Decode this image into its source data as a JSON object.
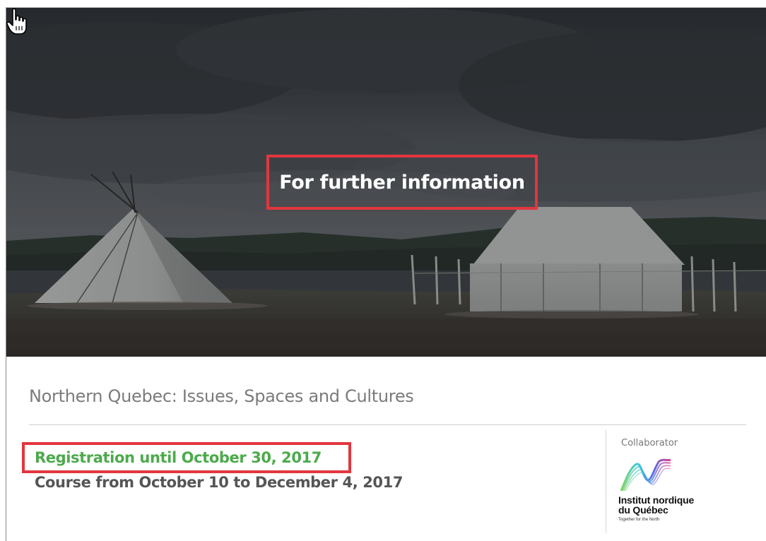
{
  "hero": {
    "link_label": "For further information",
    "image_description_icon": "tents-landscape-photo"
  },
  "course": {
    "title": "Northern Quebec: Issues, Spaces and Cultures",
    "registration": "Registration until October 30, 2017",
    "dates": "Course from October 10 to December 4, 2017"
  },
  "collaborator": {
    "label": "Collaborator",
    "name": "Institut nordique\ndu Québec",
    "tagline": "Together for the North"
  },
  "colors": {
    "highlight_border": "#e2363e",
    "registration_text": "#4caa4c",
    "dates_text": "#555555",
    "title_text": "#7b7b7b"
  }
}
